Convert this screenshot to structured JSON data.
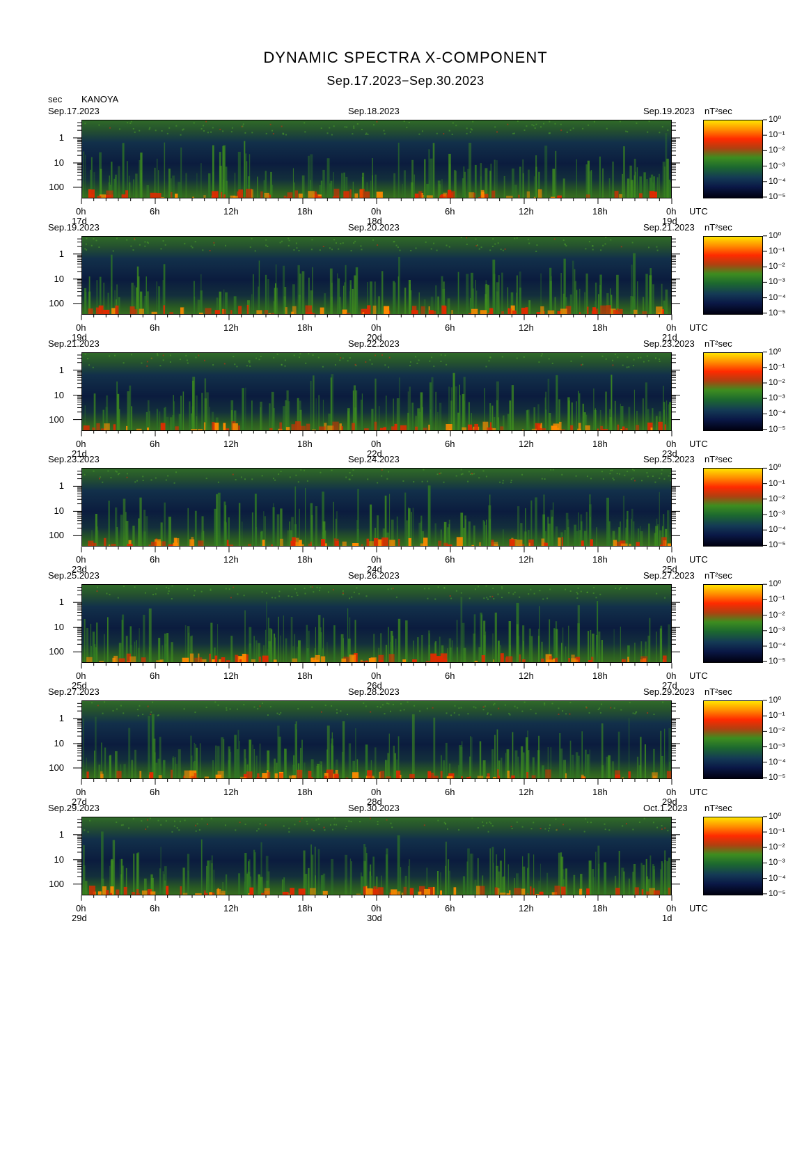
{
  "chart_data": {
    "type": "heatmap",
    "title": "DYNAMIC SPECTRA X-COMPONENT",
    "subtitle": "Sep.17.2023−Sep.30.2023",
    "station": "KANOYA",
    "yunit": "sec",
    "period_ticks": [
      "1",
      "10",
      "100"
    ],
    "time_ticks": [
      "0h",
      "6h",
      "12h",
      "18h",
      "0h",
      "6h",
      "12h",
      "18h",
      "0h"
    ],
    "time_unit": "UTC",
    "colorbar_unit": "nT²sec",
    "colorbar_ticks": [
      "10⁰",
      "10⁻¹",
      "10⁻²",
      "10⁻³",
      "10⁻⁴",
      "10⁻⁵"
    ],
    "colorscale": [
      "#000010",
      "#143a55",
      "#1d6a2e",
      "#3e8d1f",
      "#ff2a00",
      "#ff8c00",
      "#ffe400"
    ],
    "panels": [
      {
        "start_label": "Sep.17.2023",
        "mid_label": "Sep.18.2023",
        "end_label": "Sep.19.2023",
        "days": [
          "17d",
          "18d",
          "19d"
        ]
      },
      {
        "start_label": "Sep.19.2023",
        "mid_label": "Sep.20.2023",
        "end_label": "Sep.21.2023",
        "days": [
          "19d",
          "20d",
          "21d"
        ]
      },
      {
        "start_label": "Sep.21.2023",
        "mid_label": "Sep.22.2023",
        "end_label": "Sep.23.2023",
        "days": [
          "21d",
          "22d",
          "23d"
        ]
      },
      {
        "start_label": "Sep.23.2023",
        "mid_label": "Sep.24.2023",
        "end_label": "Sep.25.2023",
        "days": [
          "23d",
          "24d",
          "25d"
        ]
      },
      {
        "start_label": "Sep.25.2023",
        "mid_label": "Sep.26.2023",
        "end_label": "Sep.27.2023",
        "days": [
          "25d",
          "26d",
          "27d"
        ]
      },
      {
        "start_label": "Sep.27.2023",
        "mid_label": "Sep.28.2023",
        "end_label": "Sep.29.2023",
        "days": [
          "27d",
          "28d",
          "29d"
        ]
      },
      {
        "start_label": "Sep.29.2023",
        "mid_label": "Sep.30.2023",
        "end_label": "Oct.1.2023",
        "days": [
          "29d",
          "30d",
          "1d"
        ]
      }
    ]
  }
}
